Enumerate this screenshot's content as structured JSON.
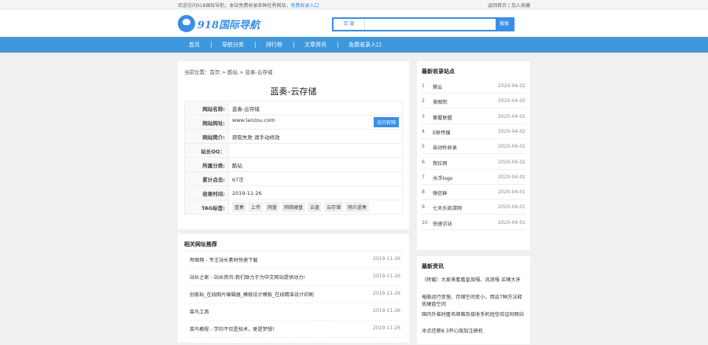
{
  "topbar": {
    "welcome": "欢迎访问918国际导航，本站免费收录各种优秀网站，",
    "submit_link": "免费收录入口",
    "home_link": "返回首页",
    "fav_link": "加入收藏"
  },
  "header": {
    "logo_text": "918国际导航",
    "search_engine": "百 度",
    "search_button": "搜索"
  },
  "nav": {
    "items": [
      "首页",
      "导航分类",
      "排行榜",
      "文章资讯",
      "免费收录入口"
    ]
  },
  "breadcrumb": {
    "text": "当前位置：首页 > 酷站 > 蓝奏-云存储"
  },
  "site": {
    "title": "蓝奏-云存储",
    "visit_button": "访问官网",
    "rows": [
      {
        "key": "网站名称:",
        "value": "蓝奏-云存储"
      },
      {
        "key": "网站网址:",
        "value": "www.lanzou.com"
      },
      {
        "key": "网站简介:",
        "value": "获取失败 请手动修改"
      },
      {
        "key": "站长QQ：",
        "value": ""
      },
      {
        "key": "所属分类:",
        "value": "酷站"
      },
      {
        "key": "累计点击:",
        "value": "67次"
      },
      {
        "key": "收录时间:",
        "value": "2019-11-26"
      },
      {
        "key": "TAG标签:",
        "value": ""
      }
    ],
    "tags": [
      "蓝奏",
      "上传",
      "网盘",
      "网络硬盘",
      "云盘",
      "云存储",
      "网众蓝奏"
    ]
  },
  "related": {
    "title": "相关网址推荐",
    "items": [
      {
        "title": "有图网 - 专注站长素材快速下载",
        "date": "2019-11-26"
      },
      {
        "title": "站长之家 - 站长资讯-我们致力于为中文网站提供动力!",
        "date": "2019-11-26"
      },
      {
        "title": "创客贴_在线图片编辑器_模板设计模板_在线精准设计印刷",
        "date": "2019-11-26"
      },
      {
        "title": "菜鸟工具",
        "date": "2019-11-26"
      },
      {
        "title": "菜鸟教程 - 学的不仅是技术，更是梦想！",
        "date": "2019-11-26"
      }
    ]
  },
  "latest": {
    "title": "最新收录站点",
    "items": [
      {
        "n": "1",
        "name": "樊云",
        "date": "2020-04-02"
      },
      {
        "n": "2",
        "name": "美图院",
        "date": "2020-04-02"
      },
      {
        "n": "3",
        "name": "掌握联盟",
        "date": "2020-04-02"
      },
      {
        "n": "4",
        "name": "E联传媒",
        "date": "2020-04-02"
      },
      {
        "n": "5",
        "name": "自动秒收录",
        "date": "2020-04-02"
      },
      {
        "n": "6",
        "name": "我拉网",
        "date": "2020-04-02"
      },
      {
        "n": "7",
        "name": "水浮logo",
        "date": "2020-04-02"
      },
      {
        "n": "8",
        "name": "微信群",
        "date": "2020-04-01"
      },
      {
        "n": "9",
        "name": "七天乐旅游网",
        "date": "2020-04-01"
      },
      {
        "n": "10",
        "name": "快速访站",
        "date": "2020-04-01"
      }
    ]
  },
  "news": {
    "title": "最新资讯",
    "items": [
      "（转载）大家来看看皇族嘎、流浪嘎 买辣大牙",
      "电脑运行变慢、存储空间变小，用这7种方法释放硬盘空间",
      "国内外临时匿名邮箱及接收手机短信验证码网站",
      "冰点还原8.3开心版加注册机"
    ]
  },
  "colors": {
    "accent": "#3a8ee6",
    "nav": "#3f97dc",
    "background": "#f0f0f0"
  }
}
